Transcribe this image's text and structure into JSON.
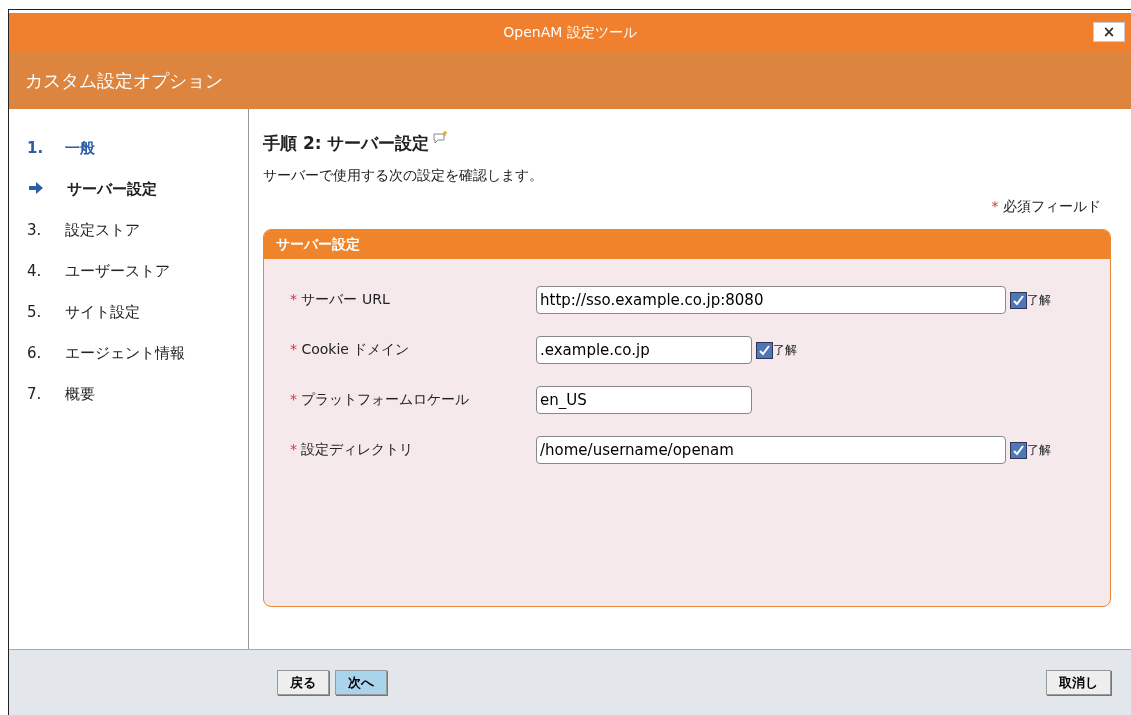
{
  "window": {
    "title": "OpenAM 設定ツール",
    "close": "×"
  },
  "header": {
    "title": "カスタム設定オプション"
  },
  "steps": [
    {
      "number": "1.",
      "label": "一般",
      "selected": false,
      "completed": true
    },
    {
      "label": "サーバー設定",
      "selected": true,
      "completed": false
    },
    {
      "number": "3.",
      "label": "設定ストア",
      "selected": false,
      "completed": false
    },
    {
      "number": "4.",
      "label": "ユーザーストア",
      "selected": false,
      "completed": false
    },
    {
      "number": "5.",
      "label": "サイト設定",
      "selected": false,
      "completed": false
    },
    {
      "number": "6.",
      "label": "エージェント情報",
      "selected": false,
      "completed": false
    },
    {
      "number": "7.",
      "label": "概要",
      "selected": false,
      "completed": false
    }
  ],
  "page": {
    "title": "手順 2: サーバー設定",
    "description": "サーバーで使用する次の設定を確認します。",
    "required_mark": "*",
    "required_note": "必須フィールド"
  },
  "panel": {
    "title": "サーバー設定",
    "fields": [
      {
        "label": "サーバー URL",
        "required": true,
        "value": "http://sso.example.co.jp:8080",
        "kind": "long",
        "confirm": {
          "label": "了解",
          "checked": true
        }
      },
      {
        "label": "Cookie ドメイン",
        "required": true,
        "value": ".example.co.jp",
        "kind": "short",
        "confirm": {
          "label": "了解",
          "checked": true
        }
      },
      {
        "label": "プラットフォームロケール",
        "required": true,
        "value": "en_US",
        "kind": "short"
      },
      {
        "label": "設定ディレクトリ",
        "required": true,
        "value": "/home/username/openam",
        "kind": "long",
        "confirm": {
          "label": "了解",
          "checked": true
        }
      }
    ]
  },
  "footer": {
    "buttons": [
      {
        "label": "戻る",
        "selected": false
      },
      {
        "label": "次へ",
        "selected": true
      }
    ],
    "cancel": "取消し"
  }
}
